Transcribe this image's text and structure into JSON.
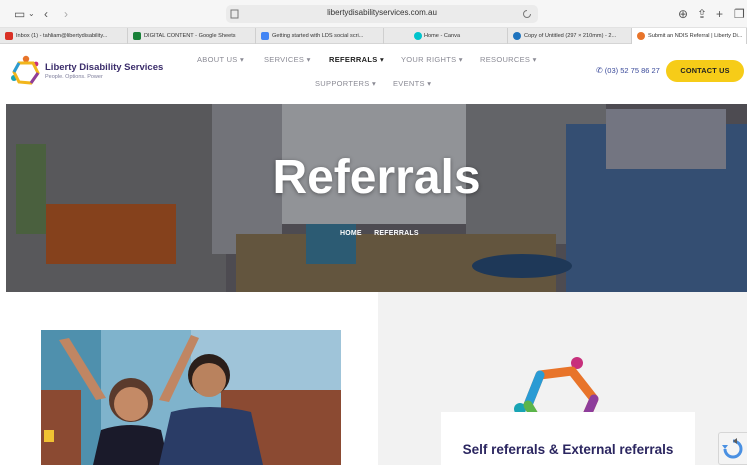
{
  "browser": {
    "url": "libertydisabilityservices.com.au",
    "tabs": [
      {
        "label": "Inbox (1) - tahliam@libertydisability...",
        "color": "#d93025"
      },
      {
        "label": "DIGITAL CONTENT - Google Sheets",
        "color": "#188038"
      },
      {
        "label": "Getting started with LDS social scri...",
        "color": "#4285f4"
      },
      {
        "label": "Home - Canva",
        "color": "#00c4cc"
      },
      {
        "label": "Copy of Untitled (297 × 210mm) - 2...",
        "color": "#1e73be"
      },
      {
        "label": "Submit an NDIS Referral | Liberty Di...",
        "color": "#e8742a"
      }
    ]
  },
  "header": {
    "logo_name": "Liberty Disability Services",
    "logo_tagline": "People. Options. Power",
    "nav": [
      {
        "label": "ABOUT US",
        "active": false
      },
      {
        "label": "SERVICES",
        "active": false
      },
      {
        "label": "REFERRALS",
        "active": true
      },
      {
        "label": "YOUR RIGHTS",
        "active": false
      },
      {
        "label": "RESOURCES",
        "active": false
      },
      {
        "label": "SUPPORTERS",
        "active": false
      },
      {
        "label": "EVENTS",
        "active": false
      }
    ],
    "phone": "(03) 52 75 86 27",
    "contact_label": "CONTACT US"
  },
  "hero": {
    "title": "Referrals",
    "breadcrumb_home": "HOME",
    "breadcrumb_current": "REFERRALS"
  },
  "section": {
    "card_title": "Self referrals & External referrals"
  },
  "colors": {
    "brand_purple": "#3b2d6b",
    "accent_yellow": "#f6cc18"
  }
}
